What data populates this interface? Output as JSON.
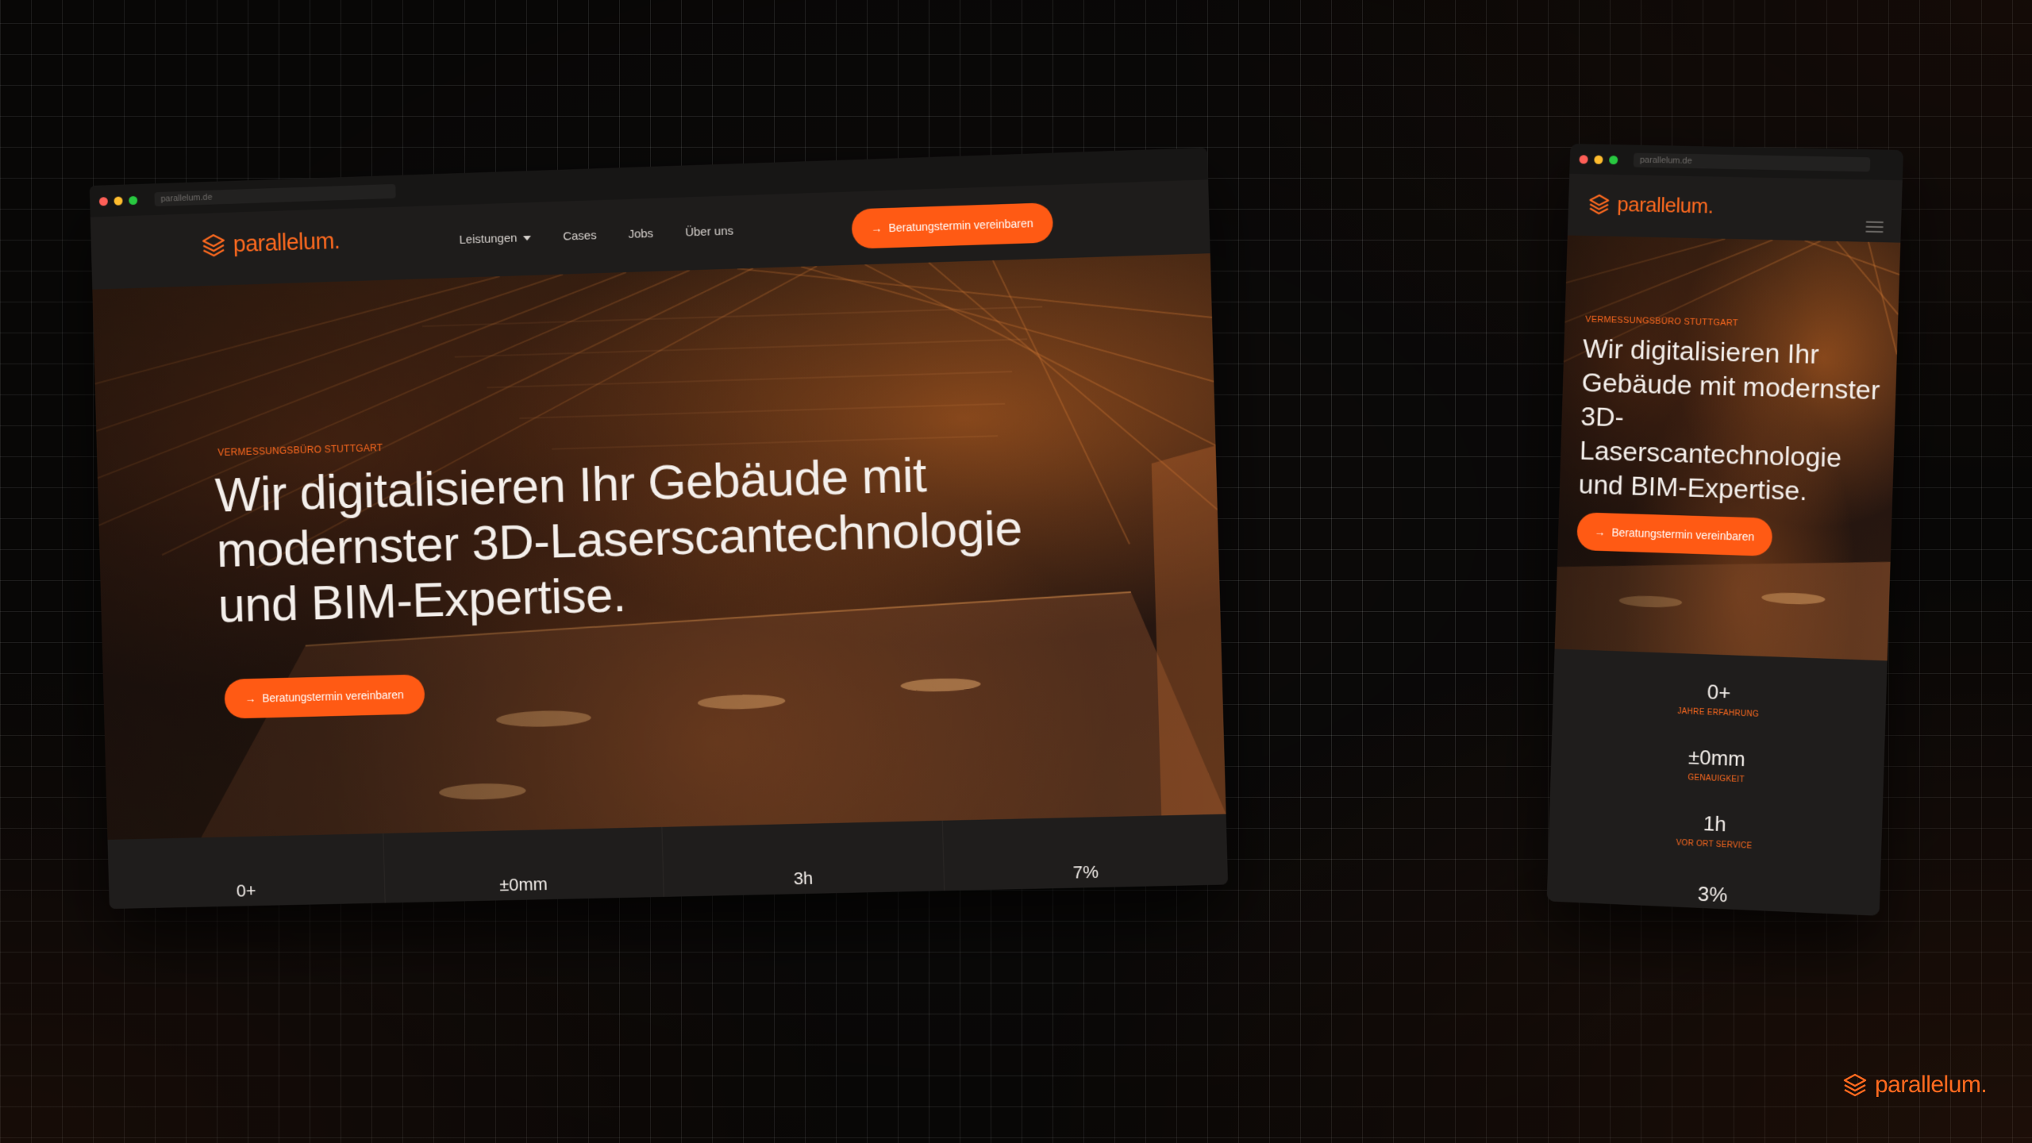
{
  "colors": {
    "accent": "#ff5a14",
    "brand": "#ff6a1f",
    "background": "#0c0a09",
    "text": "#f4efeb"
  },
  "brand": {
    "name": "parallelum",
    "dot": ".",
    "logo_icon": "stacked-layers-icon"
  },
  "desktop": {
    "browser": {
      "url": "parallelum.de"
    },
    "nav": {
      "items": [
        {
          "label": "Leistungen",
          "has_dropdown": true
        },
        {
          "label": "Cases"
        },
        {
          "label": "Jobs"
        },
        {
          "label": "Über uns"
        }
      ],
      "cta_label": "Beratungstermin vereinbaren"
    },
    "hero": {
      "eyebrow": "VERMESSUNGSBÜRO STUTTGART",
      "headline": "Wir digitalisieren Ihr Gebäude mit modernster 3D-Laserscantechnologie und BIM-Expertise.",
      "cta_label": "Beratungstermin vereinbaren"
    },
    "stats": [
      {
        "value": "0+"
      },
      {
        "value": "±0mm"
      },
      {
        "value": "3h"
      },
      {
        "value": "7%"
      }
    ]
  },
  "mobile": {
    "browser": {
      "url": "parallelum.de"
    },
    "menu_icon": "hamburger-icon",
    "hero": {
      "eyebrow": "VERMESSUNGSBÜRO STUTTGART",
      "headline": "Wir digitalisieren Ihr Gebäude mit modernster 3D-Laserscantechnologie und BIM-Expertise.",
      "cta_label": "Beratungstermin vereinbaren"
    },
    "stats": [
      {
        "value": "0+",
        "label": "JAHRE ERFAHRUNG"
      },
      {
        "value": "±0mm",
        "label": "GENAUIGKEIT"
      },
      {
        "value": "1h",
        "label": "VOR ORT SERVICE"
      },
      {
        "value": "3%",
        "label": ""
      }
    ]
  }
}
